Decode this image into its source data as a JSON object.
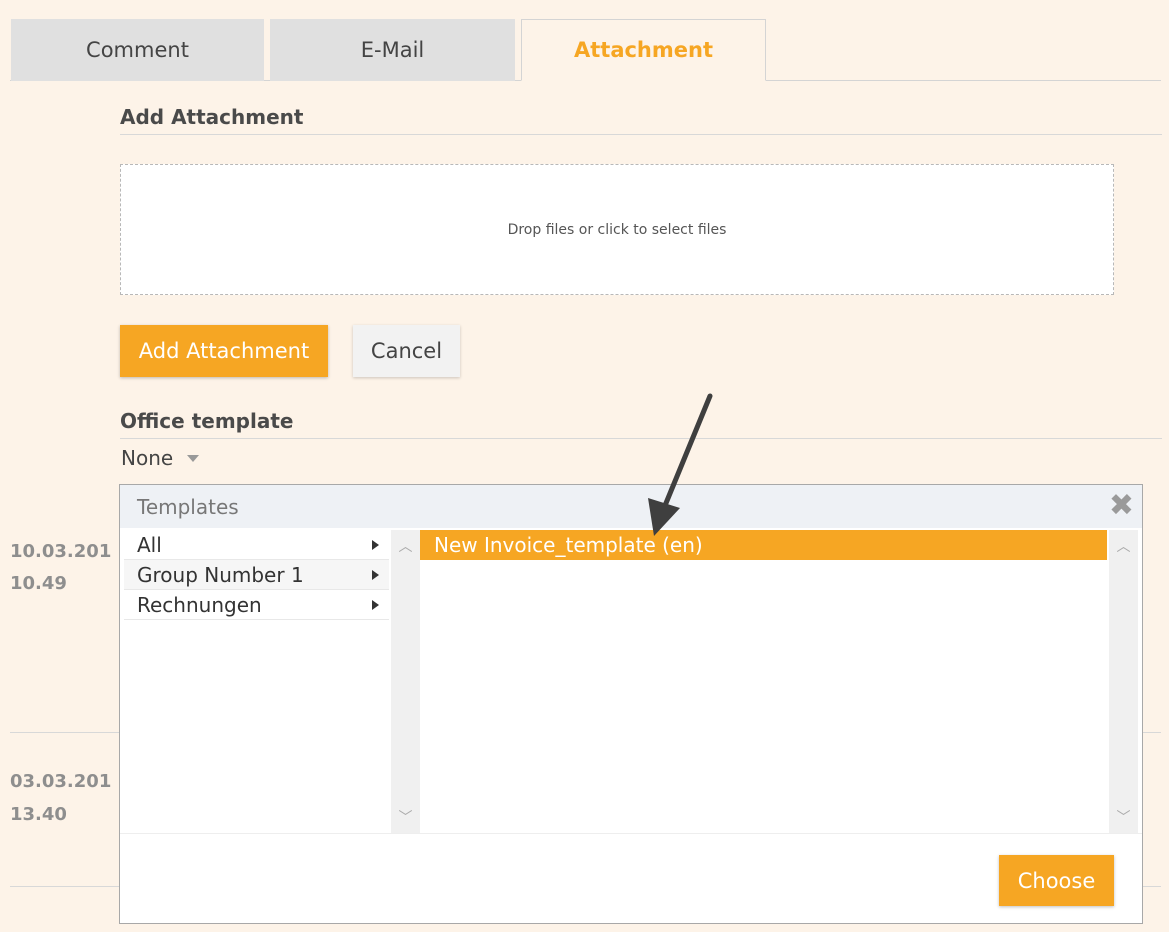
{
  "tabs": [
    {
      "label": "Comment"
    },
    {
      "label": "E-Mail"
    },
    {
      "label": "Attachment"
    }
  ],
  "add_attachment": {
    "title": "Add Attachment",
    "dropzone_text": "Drop files or click to select files",
    "submit_label": "Add Attachment",
    "cancel_label": "Cancel"
  },
  "office_template": {
    "title": "Office template",
    "selected_value": "None"
  },
  "history": [
    {
      "date": "10.03.201",
      "time": "10.49"
    },
    {
      "date": "03.03.201",
      "time": "13.40"
    }
  ],
  "dialog": {
    "title": "Templates",
    "categories": [
      {
        "label": "All"
      },
      {
        "label": "Group Number 1"
      },
      {
        "label": "Rechnungen"
      }
    ],
    "templates": [
      {
        "label": "New Invoice_template (en)"
      }
    ],
    "choose_label": "Choose"
  },
  "colors": {
    "accent": "#f6a623",
    "background": "#fdf3e8"
  }
}
